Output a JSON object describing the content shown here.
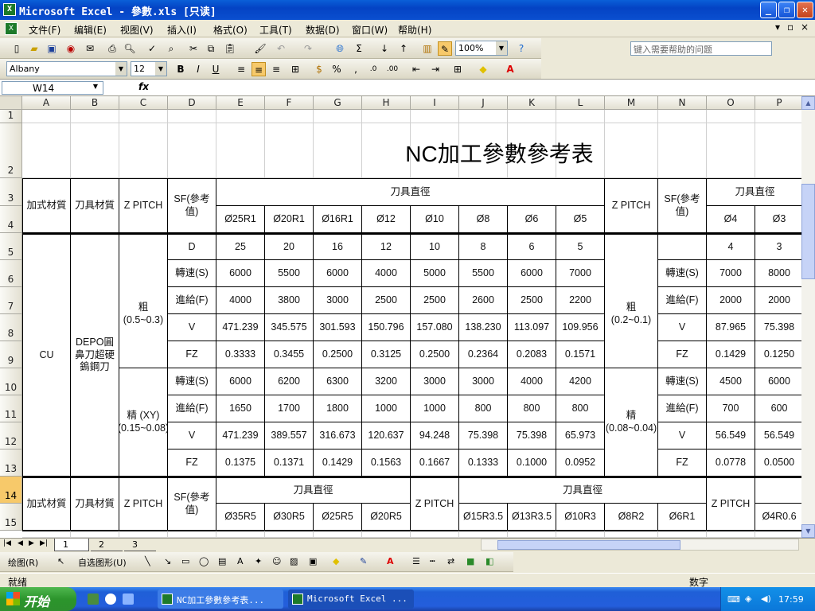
{
  "window": {
    "title": "Microsoft Excel - 參數.xls  [只读]",
    "app_icon": "excel-icon",
    "buttons": [
      "_",
      "❐",
      "✕"
    ]
  },
  "menu": [
    "文件(F)",
    "编辑(E)",
    "视图(V)",
    "插入(I)",
    "格式(O)",
    "工具(T)",
    "数据(D)",
    "窗口(W)",
    "帮助(H)"
  ],
  "help_placeholder": "键入需要帮助的问题",
  "toolbar": {
    "zoom": "100%",
    "font": "Albany",
    "size": "12"
  },
  "namebox": "W14",
  "fx": "fx",
  "columns": [
    "A",
    "B",
    "C",
    "D",
    "E",
    "F",
    "G",
    "H",
    "I",
    "J",
    "K",
    "L",
    "M",
    "N",
    "O",
    "P"
  ],
  "rows": [
    "1",
    "2",
    "3",
    "4",
    "5",
    "6",
    "7",
    "8",
    "9",
    "10",
    "11",
    "12",
    "13",
    "14",
    "15"
  ],
  "sheet": {
    "title": "NC加工參數參考表",
    "hdr": {
      "material": "加式材質",
      "tool": "刀具材質",
      "zpitch": "Z PITCH",
      "sf": "SF(參考值)",
      "dia": "刀具直徑"
    },
    "sizes1": [
      "Ø25R1",
      "Ø20R1",
      "Ø16R1",
      "Ø12",
      "Ø10",
      "Ø8",
      "Ø6",
      "Ø5"
    ],
    "sizes2": [
      "Ø4",
      "Ø3"
    ],
    "cu": "CU",
    "tool_name": "DEPO圓鼻刀超硬鎢鋼刀",
    "rough": "粗 (0.5~0.3)",
    "finish": "精 (XY) (0.15~0.08)",
    "rough2": "粗 (0.2~0.1)",
    "finish2": "精 (0.08~0.04)",
    "row_labels": [
      "D",
      "轉速(S)",
      "進給(F)",
      "V",
      "FZ",
      "轉速(S)",
      "進給(F)",
      "V",
      "FZ"
    ],
    "row_labels2": [
      "",
      "轉速(S)",
      "進給(F)",
      "V",
      "FZ",
      "轉速(S)",
      "進給(F)",
      "V",
      "FZ"
    ],
    "data1": [
      [
        "25",
        "20",
        "16",
        "12",
        "10",
        "8",
        "6",
        "5"
      ],
      [
        "6000",
        "5500",
        "6000",
        "4000",
        "5000",
        "5500",
        "6000",
        "7000"
      ],
      [
        "4000",
        "3800",
        "3000",
        "2500",
        "2500",
        "2600",
        "2500",
        "2200"
      ],
      [
        "471.239",
        "345.575",
        "301.593",
        "150.796",
        "157.080",
        "138.230",
        "113.097",
        "109.956"
      ],
      [
        "0.3333",
        "0.3455",
        "0.2500",
        "0.3125",
        "0.2500",
        "0.2364",
        "0.2083",
        "0.1571"
      ],
      [
        "6000",
        "6200",
        "6300",
        "3200",
        "3000",
        "3000",
        "4000",
        "4200"
      ],
      [
        "1650",
        "1700",
        "1800",
        "1000",
        "1000",
        "800",
        "800",
        "800"
      ],
      [
        "471.239",
        "389.557",
        "316.673",
        "120.637",
        "94.248",
        "75.398",
        "75.398",
        "65.973"
      ],
      [
        "0.1375",
        "0.1371",
        "0.1429",
        "0.1563",
        "0.1667",
        "0.1333",
        "0.1000",
        "0.0952"
      ]
    ],
    "data2": [
      [
        "4",
        "3"
      ],
      [
        "7000",
        "8000"
      ],
      [
        "2000",
        "2000"
      ],
      [
        "87.965",
        "75.398"
      ],
      [
        "0.1429",
        "0.1250"
      ],
      [
        "4500",
        "6000"
      ],
      [
        "700",
        "600"
      ],
      [
        "56.549",
        "56.549"
      ],
      [
        "0.0778",
        "0.0500"
      ]
    ],
    "sizes3a": [
      "Ø35R5",
      "Ø30R5",
      "Ø25R5",
      "Ø20R5"
    ],
    "sizes3b": [
      "Ø15R3.5",
      "Ø13R3.5",
      "Ø10R3",
      "Ø8R2",
      "Ø6R1"
    ],
    "sizes3c": [
      "Ø4R0.6"
    ]
  },
  "tabs": [
    "1",
    "2",
    "3"
  ],
  "drawbar": {
    "draw": "绘图(R)",
    "autoshape": "自选图形(U)"
  },
  "status": {
    "left": "就绪",
    "right": "数字"
  },
  "taskbar": {
    "start": "开始",
    "tasks": [
      "NC加工參數參考表...",
      "Microsoft Excel ..."
    ],
    "clock": "17:59"
  }
}
